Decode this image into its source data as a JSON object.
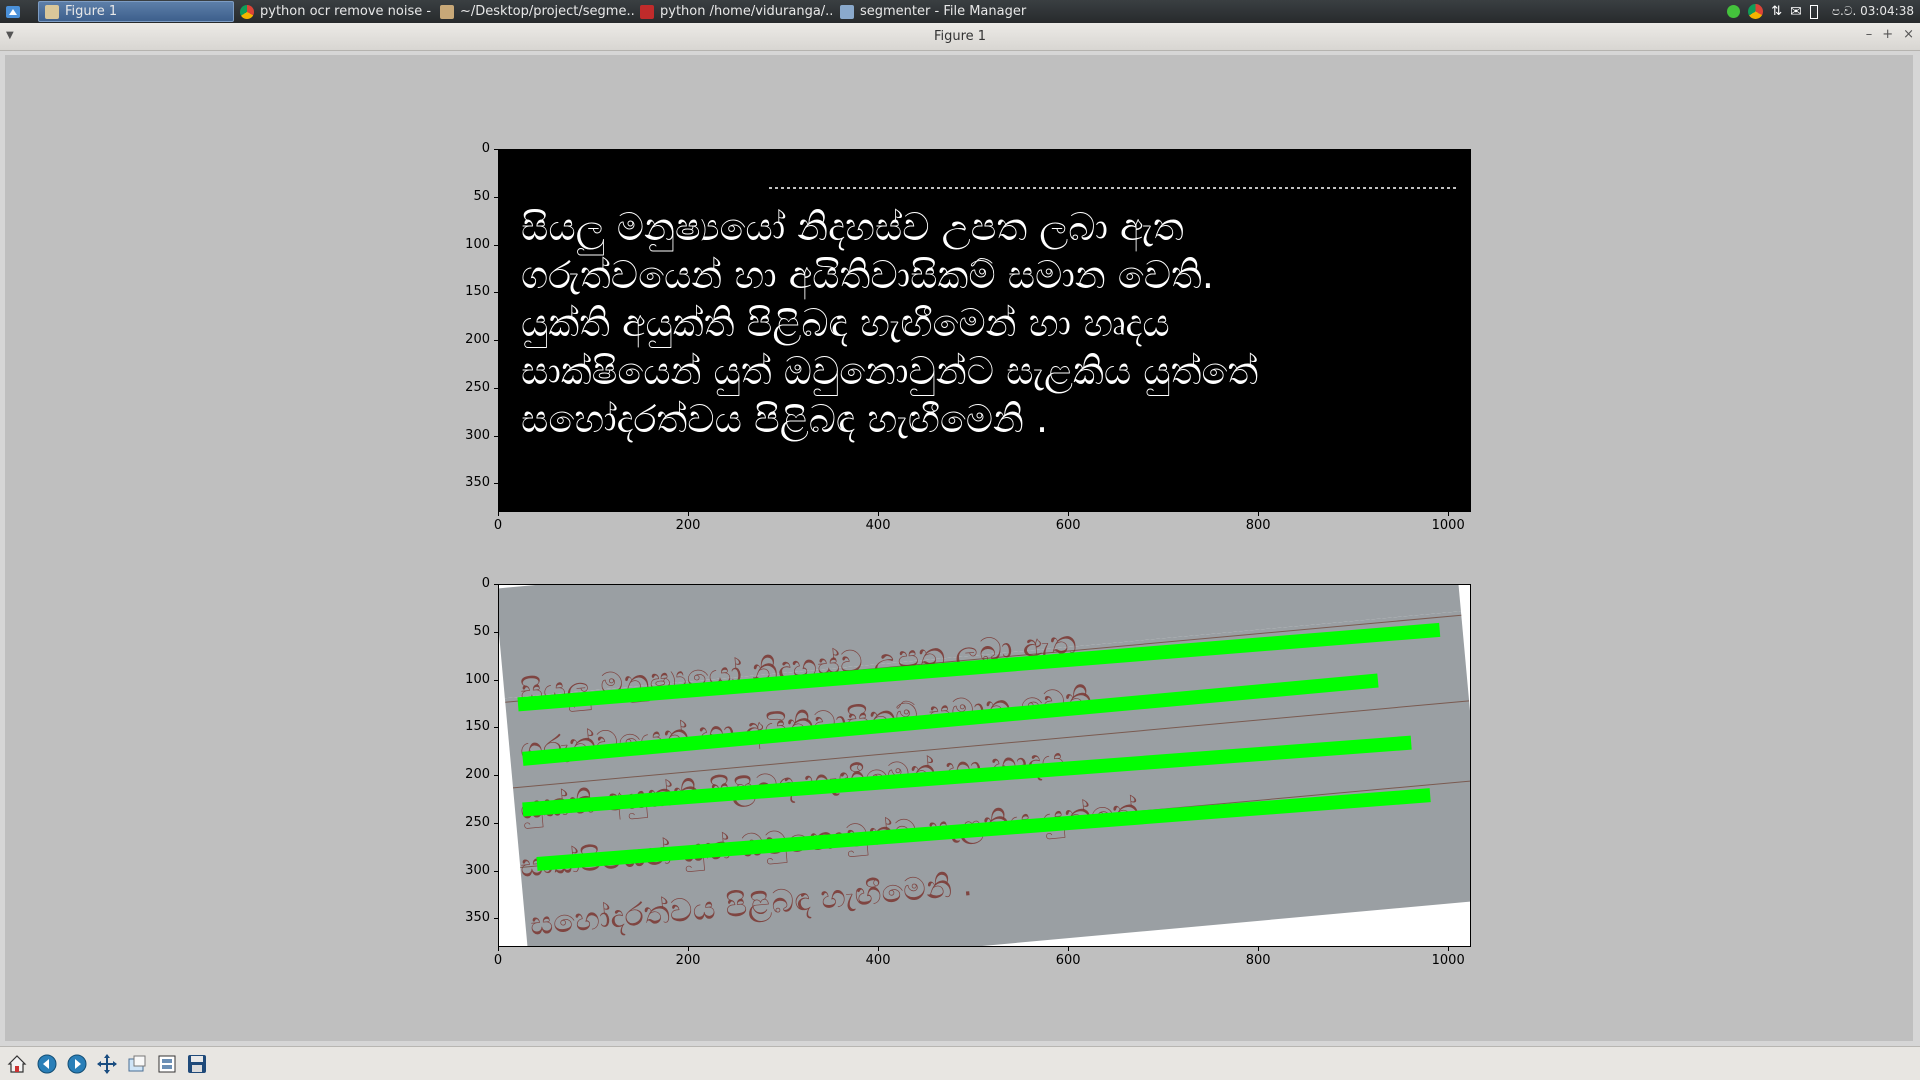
{
  "taskbar": {
    "tasks": [
      {
        "label": "Figure 1",
        "icon": "matplotlib-icon",
        "active": true
      },
      {
        "label": "python ocr remove noise - ...",
        "icon": "chrome-icon"
      },
      {
        "label": "~/Desktop/project/segme...",
        "icon": "text-editor-icon"
      },
      {
        "label": "python  /home/viduranga/...",
        "icon": "terminal-icon"
      },
      {
        "label": "segmenter - File Manager",
        "icon": "folder-icon"
      }
    ],
    "tray_icons": [
      "status-green-icon",
      "chrome-icon",
      "network-transfer-icon",
      "mail-icon",
      "battery-icon"
    ],
    "clock": "ප.ව. 03:04:38"
  },
  "window": {
    "title": "Figure 1",
    "controls": [
      "–",
      "+",
      "×"
    ]
  },
  "plots": [
    {
      "name": "binarized-image-plot",
      "xticks": [
        "0",
        "200",
        "400",
        "600",
        "800",
        "1000"
      ],
      "yticks": [
        "0",
        "50",
        "100",
        "150",
        "200",
        "250",
        "300",
        "350"
      ],
      "xlim": [
        0,
        1024
      ],
      "ylim": [
        380,
        0
      ],
      "image": "binary-handwriting-image",
      "text_lines": [
        "සියලු  මනුෂ්‍යයෝ  නිදහස්ව  උපත  ලබා  ඇත",
        "ගරුත්වයෙන්  හා  අයිතිවාසිකම්  සමාන  වෙති.",
        "යුක්ති  අයුක්ති  පිළිබඳ  හැඟීමෙන්  හා  හෘදය",
        "සාක්ෂියෙන්  යුත්  ඔවුනොවුන්ට  සැළකිය  යුත්තේ",
        "සහෝදරත්වය  පිළිබඳ  හැඟීමෙනි ."
      ]
    },
    {
      "name": "segmented-photo-plot",
      "xticks": [
        "0",
        "200",
        "400",
        "600",
        "800",
        "1000"
      ],
      "yticks": [
        "0",
        "50",
        "100",
        "150",
        "200",
        "250",
        "300",
        "350"
      ],
      "xlim": [
        0,
        1024
      ],
      "ylim": [
        380,
        0
      ],
      "image": "rotated-handwriting-photo",
      "segment_lines": [
        {
          "x1": 20,
          "y1": 125,
          "x2": 990,
          "y2": 47
        },
        {
          "x1": 25,
          "y1": 182,
          "x2": 925,
          "y2": 100
        },
        {
          "x1": 25,
          "y1": 235,
          "x2": 960,
          "y2": 165
        },
        {
          "x1": 40,
          "y1": 292,
          "x2": 980,
          "y2": 220
        }
      ],
      "text_lines": [
        "සියලු  මනුෂ්‍යයෝ  නිදහස්ව  උපත  ලබා  ඇත",
        "ගරුත්වයෙන්  හා  අයිතිවාසිකම්  සමාන  වෙති.",
        "යුක්ති  අයුක්ති  පිළිබඳ  හැඟීමෙන්  හා  හෘදය",
        "සාක්ෂියෙන්  යුත්  ඔවුනොවුන්ට  සැළකිය  යුත්තේ",
        "සහෝදරත්වය  පිළිබඳ  හැඟීමෙනි ."
      ],
      "highlight_color": "#00ff00",
      "paper_color": "#9a9fa3",
      "ink_color": "#7a3530"
    }
  ],
  "toolbar": {
    "buttons": [
      {
        "name": "home-button",
        "icon": "home-icon"
      },
      {
        "name": "back-button",
        "icon": "back-arrow-icon"
      },
      {
        "name": "forward-button",
        "icon": "forward-arrow-icon"
      },
      {
        "name": "pan-button",
        "icon": "pan-cross-icon"
      },
      {
        "name": "zoom-button",
        "icon": "zoom-rect-icon"
      },
      {
        "name": "subplots-button",
        "icon": "subplots-config-icon"
      },
      {
        "name": "save-button",
        "icon": "floppy-disk-icon"
      }
    ]
  }
}
